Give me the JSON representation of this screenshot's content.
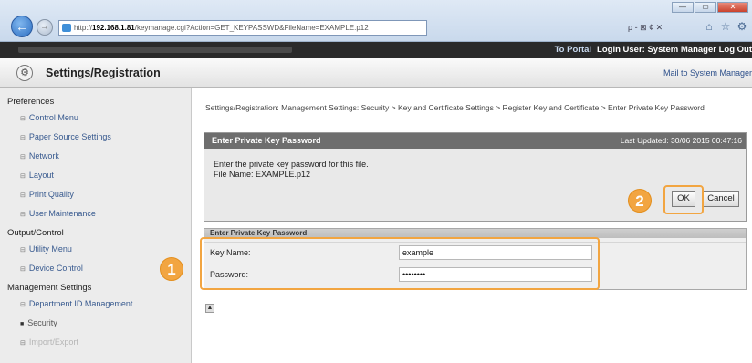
{
  "browser": {
    "address_host": "192.168.1.81",
    "address_prefix": "http://",
    "address_path": "/keymanage.cgi?Action=GET_KEYPASSWD&FileName=EXAMPLE.p12",
    "search_label": "ρ - ⊠ ¢ ✕",
    "window_controls": [
      "—",
      "▭",
      "✕"
    ]
  },
  "topbar": {
    "portal_link": "To Portal",
    "login_text": "Login User: System Manager Log Out"
  },
  "titlebar": {
    "heading": "Settings/Registration",
    "mail_link": "Mail to System Manager"
  },
  "sidebar": {
    "sections": [
      {
        "title": "Preferences",
        "items": [
          "Control Menu",
          "Paper Source Settings",
          "Network",
          "Layout",
          "Print Quality",
          "User Maintenance"
        ]
      },
      {
        "title": "Output/Control",
        "items": [
          "Utility Menu",
          "Device Control"
        ]
      },
      {
        "title": "Management Settings",
        "items": [
          "Department ID Management",
          "Security",
          "Import/Export"
        ]
      }
    ]
  },
  "breadcrumb": "Settings/Registration: Management Settings: Security > Key and Certificate Settings > Register Key and Certificate > Enter Private Key Password",
  "panel": {
    "title": "Enter Private Key Password",
    "last_updated": "Last Updated: 30/06 2015 00:47:16",
    "instruction": "Enter the private key password for this file.",
    "file_name": "File Name: EXAMPLE.p12",
    "ok_label": "OK",
    "cancel_label": "Cancel"
  },
  "form": {
    "header": "Enter Private Key Password",
    "key_name_label": "Key Name:",
    "key_name_value": "example",
    "password_label": "Password:",
    "password_value": "••••••••"
  },
  "callouts": {
    "one": "1",
    "two": "2"
  },
  "colors": {
    "callout": "#f2a541",
    "panel_header": "#6e6e6e",
    "topbar": "#2a2a2a"
  }
}
